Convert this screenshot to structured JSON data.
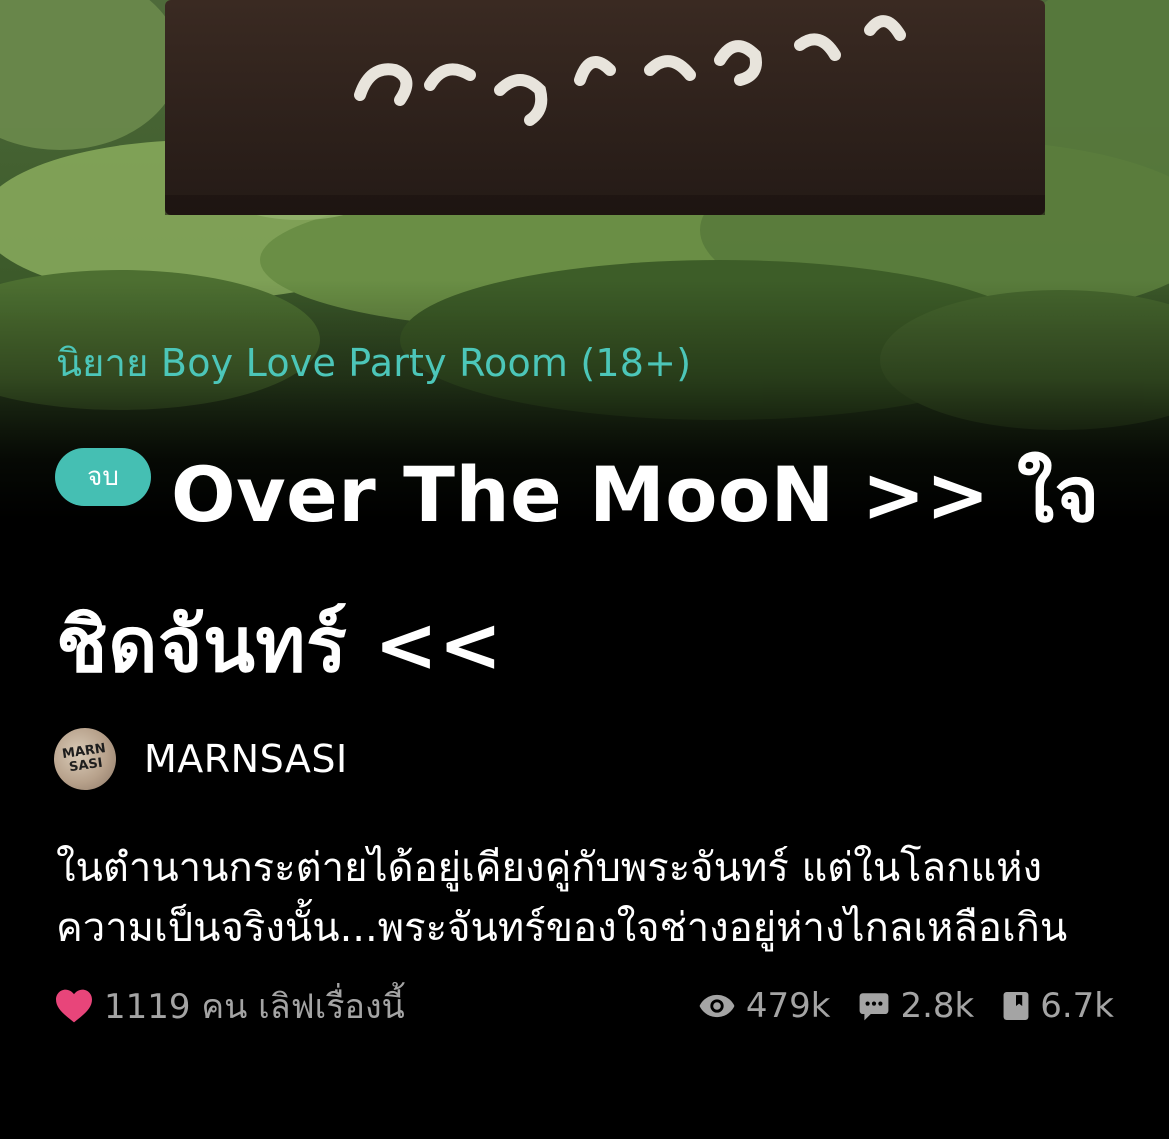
{
  "novel": {
    "category": "นิยาย Boy Love Party Room (18+)",
    "status_badge": "จบ",
    "title": "Over The MooN >> ใจชิดจันทร์ <<",
    "author": {
      "name": "MARNSASI",
      "avatar_text": "MARN SASI"
    },
    "synopsis": "ในตำนานกระต่ายได้อยู่เคียงคู่กับพระจันทร์ แต่ในโลกแห่งความเป็นจริงนั้น...พระจันทร์ของใจช่างอยู่ห่างไกลเหลือเกิน",
    "stats": {
      "likes_text": "1119 คน เลิฟเรื่องนี้",
      "views": "479k",
      "comments": "2.8k",
      "bookmarks": "6.7k"
    }
  },
  "colors": {
    "accent": "#45bfb3",
    "category_text": "#4cc6b9",
    "heart": "#e8457a",
    "stat_text": "#a4a4a4",
    "background": "#000000"
  },
  "icons": {
    "like": "heart-icon",
    "views": "eye-icon",
    "comments": "comment-icon",
    "bookmarks": "bookmark-icon"
  }
}
